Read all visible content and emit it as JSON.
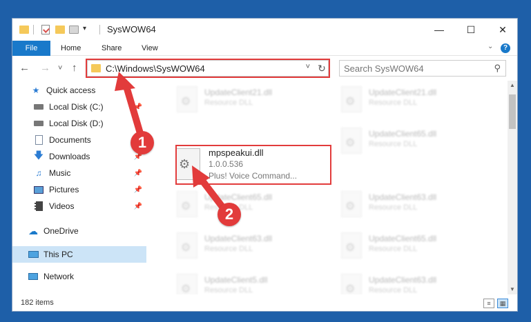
{
  "window": {
    "title": "SysWOW64",
    "qa_dropdown": "▾",
    "minimize": "—",
    "maximize": "☐",
    "close": "✕"
  },
  "ribbon": {
    "tabs": [
      "File",
      "Home",
      "Share",
      "View"
    ],
    "expand": "⌄",
    "help": "?"
  },
  "address": {
    "back": "←",
    "forward": "→",
    "recent": "˅",
    "up": "↑",
    "path": "C:\\Windows\\SysWOW64",
    "dropdown": "˅",
    "refresh": "↻"
  },
  "search": {
    "placeholder": "Search SysWOW64"
  },
  "sidebar": {
    "items": [
      {
        "label": "Quick access",
        "icon": "star-icon"
      },
      {
        "label": "Local Disk (C:)",
        "icon": "drive-icon"
      },
      {
        "label": "Local Disk (D:)",
        "icon": "drive-icon"
      },
      {
        "label": "Documents",
        "icon": "documents-icon"
      },
      {
        "label": "Downloads",
        "icon": "downloads-icon"
      },
      {
        "label": "Music",
        "icon": "music-icon"
      },
      {
        "label": "Pictures",
        "icon": "pictures-icon"
      },
      {
        "label": "Videos",
        "icon": "videos-icon"
      },
      {
        "label": "OneDrive",
        "icon": "cloud-icon"
      },
      {
        "label": "This PC",
        "icon": "computer-icon"
      },
      {
        "label": "Network",
        "icon": "network-icon"
      }
    ]
  },
  "files": {
    "left": [
      {
        "name": "UpdateClient21.dll",
        "type": "Resource DLL"
      },
      {
        "name": "UpdateClient65.dll",
        "type": "Resource DLL"
      },
      {
        "name": "UpdateClient63.dll",
        "type": "Resource DLL"
      },
      {
        "name": "UpdateClient5.dll",
        "type": "Resource DLL"
      }
    ],
    "right": [
      {
        "name": "UpdateClient21.dll",
        "type": "Resource DLL"
      },
      {
        "name": "UpdateClient65.dll",
        "type": "Resource DLL"
      },
      {
        "name": "UpdateClient63.dll",
        "type": "Resource DLL"
      },
      {
        "name": "UpdateClient65.dll",
        "type": "Resource DLL"
      },
      {
        "name": "UpdateClient63.dll",
        "type": "Resource DLL"
      }
    ],
    "highlighted": {
      "name": "mpspeakui.dll",
      "version": "1.0.0.536",
      "description": "Plus! Voice Command..."
    }
  },
  "status": {
    "count": "182 items"
  },
  "annotations": {
    "step1": "1",
    "step2": "2",
    "color": "#e23b3b"
  }
}
